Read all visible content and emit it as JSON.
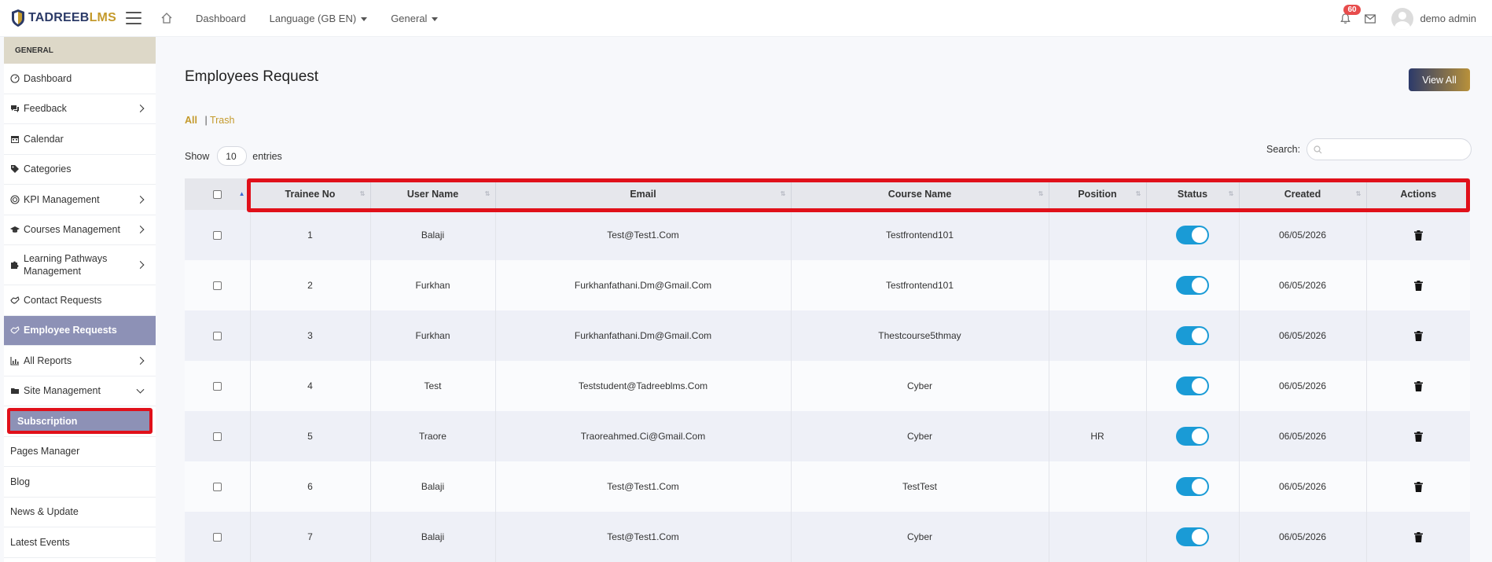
{
  "brand": {
    "name_part1": "TADREEB",
    "name_part2": "LMS"
  },
  "topnav": {
    "dashboard": "Dashboard",
    "language": "Language (GB EN)",
    "general": "General"
  },
  "topbar_right": {
    "notification_count": "60",
    "user_name": "demo admin"
  },
  "sidebar": {
    "section_label": "GENERAL",
    "items": [
      {
        "label": "Dashboard",
        "icon": "gauge-icon"
      },
      {
        "label": "Feedback",
        "icon": "chat-icon"
      },
      {
        "label": "Calendar",
        "icon": "calendar-icon"
      },
      {
        "label": "Categories",
        "icon": "tags-icon"
      },
      {
        "label": "KPI Management",
        "icon": "target-icon"
      },
      {
        "label": "Courses Management",
        "icon": "graduation-cap-icon"
      },
      {
        "label": "Learning Pathways Management",
        "icon": "puzzle-icon"
      },
      {
        "label": "Contact Requests",
        "icon": "handshake-icon"
      },
      {
        "label": "Employee Requests",
        "icon": "handshake-icon"
      },
      {
        "label": "All Reports",
        "icon": "chart-icon"
      },
      {
        "label": "Site Management",
        "icon": "folder-icon"
      }
    ],
    "sub_items": [
      "Subscription"
    ],
    "plain_items": [
      "Pages Manager",
      "Blog",
      "News & Update",
      "Latest Events"
    ]
  },
  "page": {
    "title": "Employees Request",
    "view_all": "View All",
    "filter_all": "All",
    "filter_trash": "Trash",
    "show_label": "Show",
    "entries_value": "10",
    "entries_label": "entries",
    "search_label": "Search:"
  },
  "table": {
    "columns": [
      "Trainee No",
      "User Name",
      "Email",
      "Course Name",
      "Position",
      "Status",
      "Created",
      "Actions"
    ],
    "rows": [
      {
        "no": "1",
        "user": "Balaji",
        "email": "Test@Test1.Com",
        "course": "Testfrontend101",
        "position": "",
        "created": "06/05/2026"
      },
      {
        "no": "2",
        "user": "Furkhan",
        "email": "Furkhanfathani.Dm@Gmail.Com",
        "course": "Testfrontend101",
        "position": "",
        "created": "06/05/2026"
      },
      {
        "no": "3",
        "user": "Furkhan",
        "email": "Furkhanfathani.Dm@Gmail.Com",
        "course": "Thestcourse5thmay",
        "position": "",
        "created": "06/05/2026"
      },
      {
        "no": "4",
        "user": "Test",
        "email": "Teststudent@Tadreeblms.Com",
        "course": "Cyber",
        "position": "",
        "created": "06/05/2026"
      },
      {
        "no": "5",
        "user": "Traore",
        "email": "Traoreahmed.Ci@Gmail.Com",
        "course": "Cyber",
        "position": "HR",
        "created": "06/05/2026"
      },
      {
        "no": "6",
        "user": "Balaji",
        "email": "Test@Test1.Com",
        "course": "TestTest",
        "position": "",
        "created": "06/05/2026"
      },
      {
        "no": "7",
        "user": "Balaji",
        "email": "Test@Test1.Com",
        "course": "Cyber",
        "position": "",
        "created": "06/05/2026"
      }
    ]
  },
  "colors": {
    "accent_gold": "#c49a2c",
    "brand_navy": "#2b3a67",
    "sidebar_active": "#8d91b6",
    "toggle_on": "#1a9bd6",
    "highlight_red": "#e0101a"
  }
}
